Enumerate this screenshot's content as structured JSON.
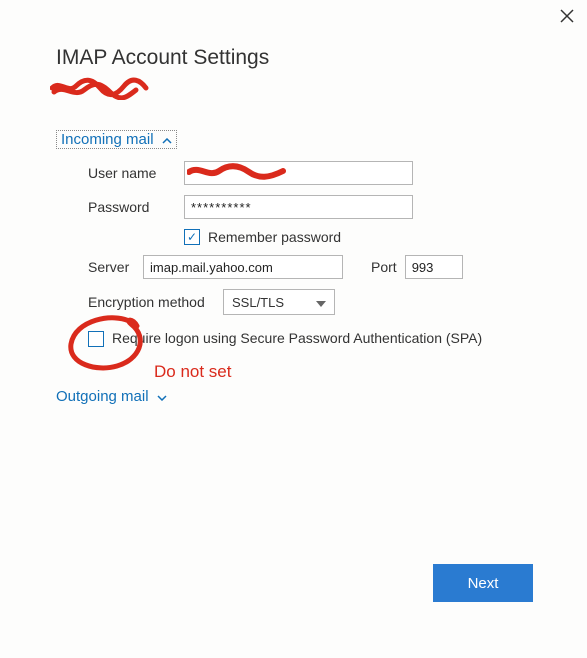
{
  "title": "IMAP Account Settings",
  "sections": {
    "incoming_label": "Incoming mail",
    "outgoing_label": "Outgoing mail"
  },
  "labels": {
    "username": "User name",
    "password": "Password",
    "remember": "Remember password",
    "server": "Server",
    "port": "Port",
    "encryption": "Encryption method",
    "spa": "Require logon using Secure Password Authentication (SPA)"
  },
  "values": {
    "username": "",
    "password": "**********",
    "server": "imap.mail.yahoo.com",
    "port": "993",
    "encryption": "SSL/TLS"
  },
  "annotation": {
    "do_not_set": "Do not set"
  },
  "buttons": {
    "next": "Next"
  }
}
